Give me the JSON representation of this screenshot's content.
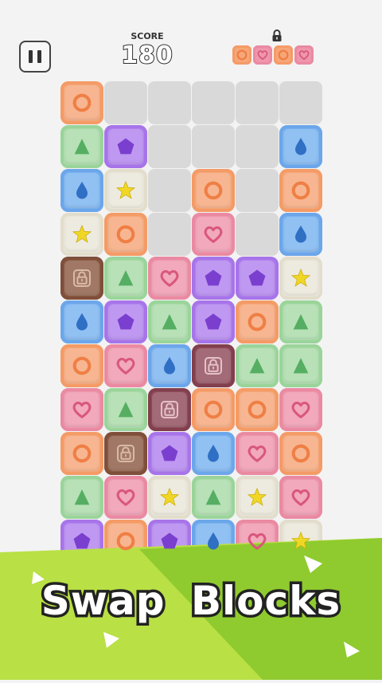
{
  "header": {
    "pause_icon": "pause-icon",
    "score_label": "SCORE",
    "score_value": "180",
    "goal_lock_icon": "lock-icon",
    "goal_tiles": [
      {
        "color": "orange",
        "symbol": "circle"
      },
      {
        "color": "pink",
        "symbol": "heart"
      },
      {
        "color": "orange",
        "symbol": "circle"
      },
      {
        "color": "pink",
        "symbol": "heart"
      }
    ]
  },
  "board": {
    "columns": 6,
    "rows": [
      [
        "orange:circle",
        null,
        null,
        null,
        null,
        null
      ],
      [
        "green:triangle",
        "purple:pentagon",
        null,
        null,
        null,
        "blue:drop"
      ],
      [
        "blue:drop",
        "cream:star",
        null,
        "orange:circle",
        null,
        "orange:circle"
      ],
      [
        "cream:star",
        "orange:circle",
        null,
        "pink:heart",
        null,
        "blue:drop"
      ],
      [
        "brown:lock",
        "green:triangle",
        "pink:heart",
        "purple:pentagon",
        "purple:pentagon",
        "cream:star"
      ],
      [
        "blue:drop",
        "purple:pentagon",
        "green:triangle",
        "purple:pentagon",
        "orange:circle",
        "green:triangle"
      ],
      [
        "orange:circle",
        "pink:heart",
        "blue:drop",
        "maroon:lock",
        "green:triangle",
        "green:triangle"
      ],
      [
        "pink:heart",
        "green:triangle",
        "maroon:lock",
        "orange:circle",
        "orange:circle",
        "pink:heart"
      ],
      [
        "orange:circle",
        "brown:lock",
        "purple:pentagon",
        "blue:drop",
        "pink:heart",
        "orange:circle"
      ],
      [
        "green:triangle",
        "pink:heart",
        "cream:star",
        "green:triangle",
        "cream:star",
        "pink:heart"
      ],
      [
        "purple:pentagon",
        "orange:circle",
        "purple:pentagon",
        "blue:drop",
        "pink:heart",
        "cream:star"
      ]
    ]
  },
  "colors": {
    "orange": {
      "fill": "#f6a679",
      "inner": "#f49b66",
      "symbol": "#ef7f45"
    },
    "pink": {
      "fill": "#ee96ac",
      "inner": "#ea8aa2",
      "symbol": "#d9577b"
    },
    "green": {
      "fill": "#a9dba8",
      "inner": "#9ad49a",
      "symbol": "#55ae62"
    },
    "purple": {
      "fill": "#b183ee",
      "inner": "#a774e9",
      "symbol": "#7b3fcf"
    },
    "blue": {
      "fill": "#79b2ef",
      "inner": "#6ca6ea",
      "symbol": "#2f6fc4"
    },
    "cream": {
      "fill": "#e9e6d8",
      "inner": "#e2ddcc",
      "symbol": "#f0d726"
    },
    "brown": {
      "fill": "#8d5b45",
      "inner": "#7f4f3a",
      "symbol": "#d9b9a7"
    },
    "maroon": {
      "fill": "#8f4b59",
      "inner": "#823f4d",
      "symbol": "#e5c1c8"
    },
    "slot": "#d9d9d9",
    "banner_light": "#b9e045",
    "banner_dark": "#8fcb2f"
  },
  "banner": {
    "text": "Swap Blocks"
  }
}
